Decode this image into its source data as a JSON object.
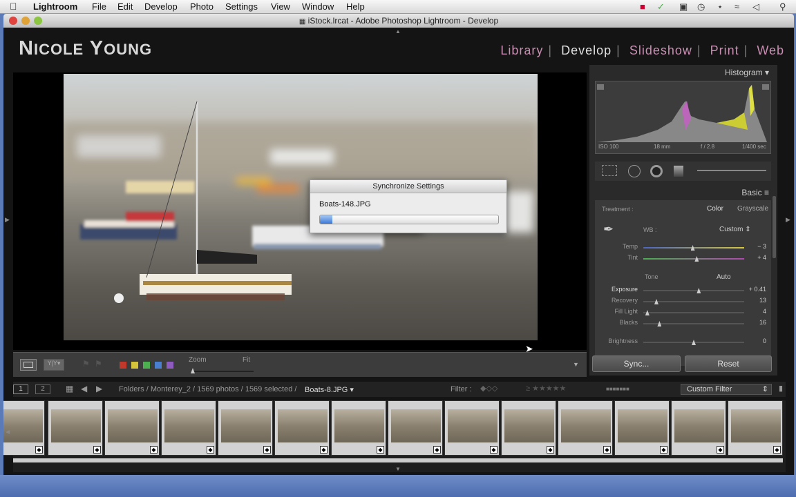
{
  "menubar": {
    "apple": "",
    "app": "Lightroom",
    "items": [
      "File",
      "Edit",
      "Develop",
      "Photo",
      "Settings",
      "View",
      "Window",
      "Help"
    ]
  },
  "window": {
    "title": "iStock.lrcat - Adobe Photoshop Lightroom - Develop"
  },
  "identity": {
    "first": "Nicole",
    "last": "Young"
  },
  "modules": [
    "Library",
    "Develop",
    "Slideshow",
    "Print",
    "Web"
  ],
  "active_module": "Develop",
  "dialog": {
    "title": "Synchronize Settings",
    "filename": "Boats-148.JPG",
    "progress": 0.07
  },
  "toolbar": {
    "zoom_label": "Zoom",
    "fit_label": "Fit",
    "flag_colors": [
      "#c0392b",
      "#d4c53a",
      "#4caf50",
      "#4a7fd0",
      "#8e5bbf"
    ]
  },
  "histogram": {
    "title": "Histogram",
    "iso": "ISO 100",
    "focal": "18 mm",
    "aperture": "f / 2.8",
    "shutter": "1/400 sec"
  },
  "basic": {
    "title": "Basic",
    "treatment_label": "Treatment :",
    "color": "Color",
    "grayscale": "Grayscale",
    "wb_label": "WB :",
    "wb_value": "Custom",
    "tone_label": "Tone",
    "auto": "Auto",
    "sliders": [
      {
        "label": "Temp",
        "value": "− 3",
        "pos": 0.49
      },
      {
        "label": "Tint",
        "value": "+ 4",
        "pos": 0.53
      },
      {
        "label": "Exposure",
        "value": "+ 0.41",
        "pos": 0.55
      },
      {
        "label": "Recovery",
        "value": "13",
        "pos": 0.13
      },
      {
        "label": "Fill Light",
        "value": "4",
        "pos": 0.04
      },
      {
        "label": "Blacks",
        "value": "16",
        "pos": 0.16
      },
      {
        "label": "Brightness",
        "value": "0",
        "pos": 0.5
      }
    ]
  },
  "buttons": {
    "sync": "Sync...",
    "reset": "Reset"
  },
  "filmstrip_bar": {
    "pages": [
      "1",
      "2"
    ],
    "path": "Folders / Monterey_2 / 1569 photos / 1569 selected /",
    "file": "Boats-8.JPG",
    "filter_label": "Filter :",
    "custom_filter": "Custom Filter"
  },
  "thumbnails": 14
}
